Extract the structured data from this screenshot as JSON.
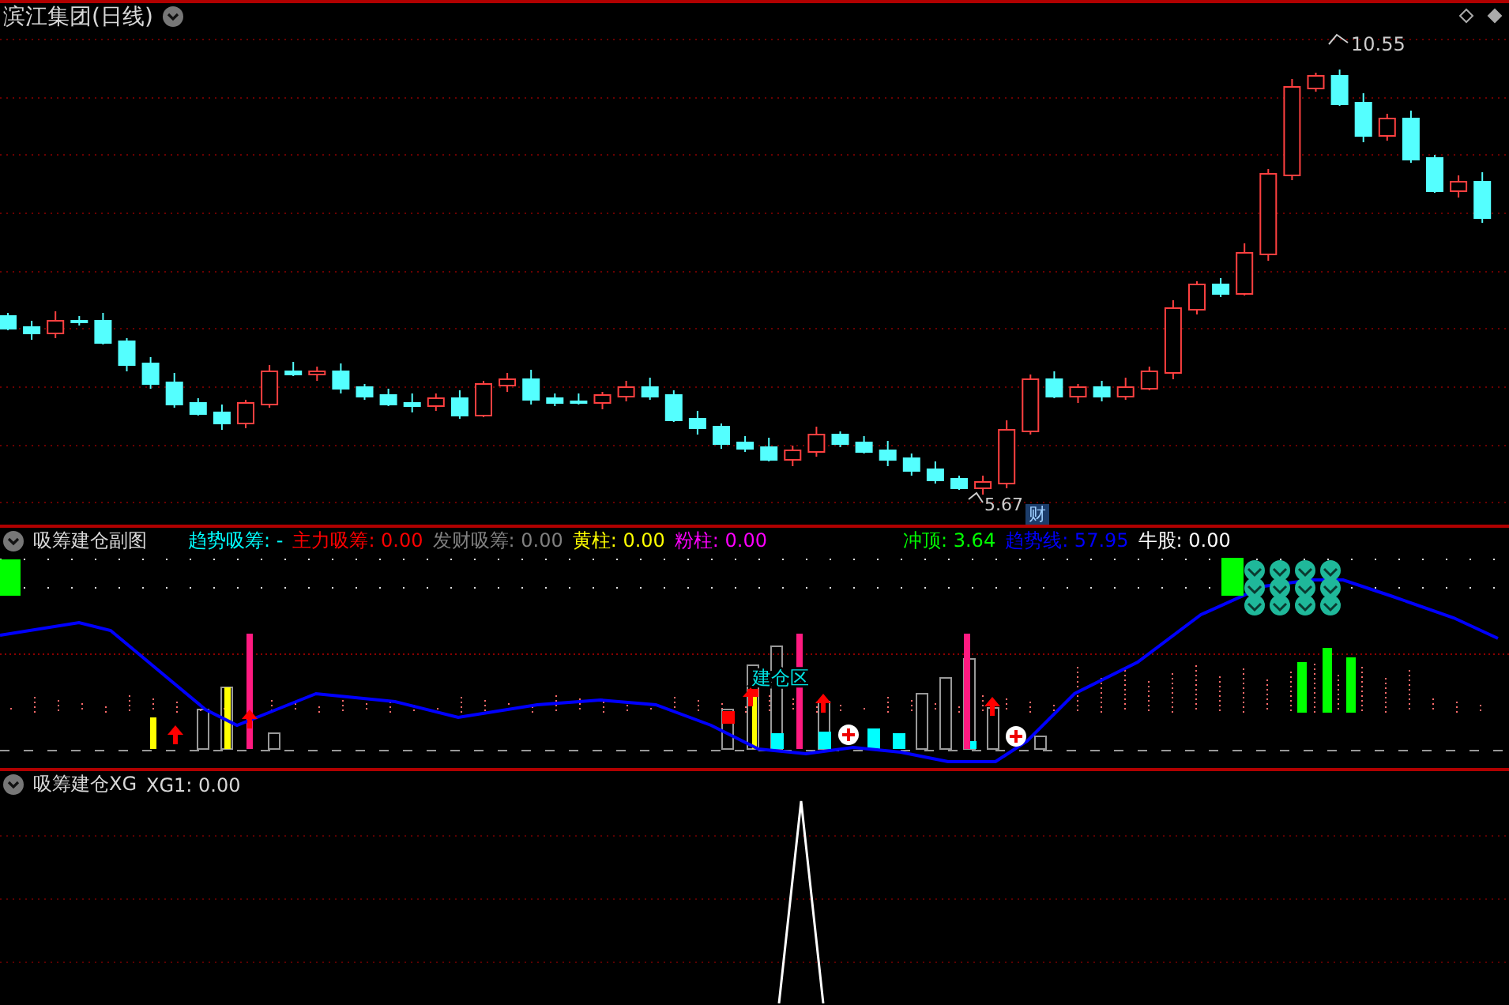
{
  "main_chart": {
    "title": "滨江集团(日线)",
    "high_label": "10.55",
    "low_label": "5.67",
    "badge": "财"
  },
  "sub_chart": {
    "title": "吸筹建仓副图",
    "zone_label": "建仓区",
    "indicators": [
      {
        "text": "趋势吸筹: -",
        "color": "#00ffff"
      },
      {
        "text": "主力吸筹: 0.00",
        "color": "#ff0000"
      },
      {
        "text": "发财吸筹: 0.00",
        "color": "#808080"
      },
      {
        "text": "黄柱: 0.00",
        "color": "#ffff00"
      },
      {
        "text": "粉柱: 0.00",
        "color": "#ff00ff"
      },
      {
        "text": "冲顶: 3.64",
        "color": "#00ff00"
      },
      {
        "text": "趋势线: 57.95",
        "color": "#0000ff"
      },
      {
        "text": "牛股: 0.00",
        "color": "#ffffff"
      }
    ]
  },
  "signal_chart": {
    "title": "吸筹建仓XG",
    "reading": "XG1: 0.00"
  }
}
